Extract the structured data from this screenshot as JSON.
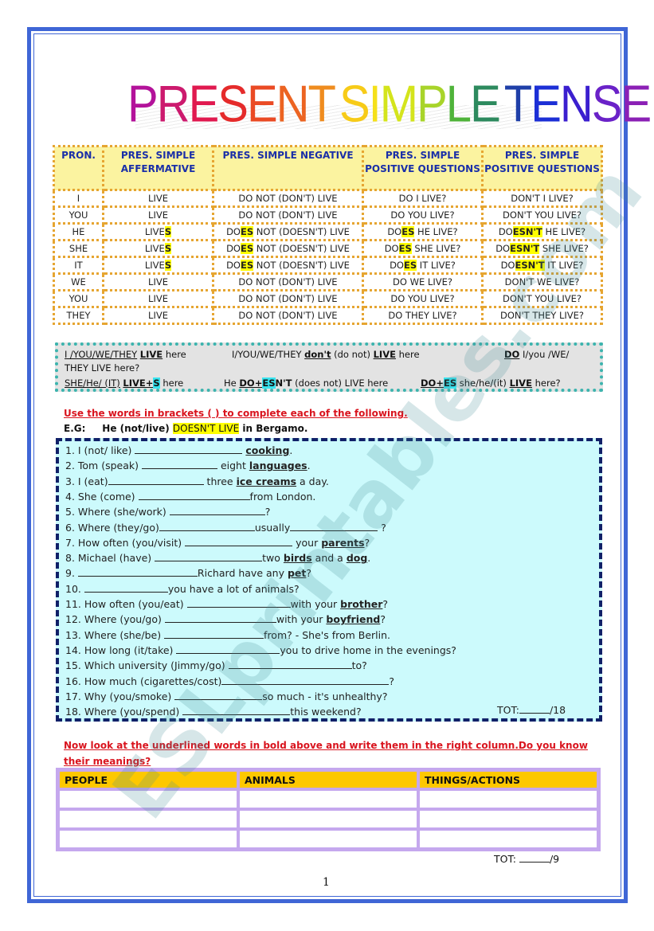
{
  "title": {
    "letters": [
      {
        "ch": "P",
        "color": "#b3129a"
      },
      {
        "ch": "R",
        "color": "#cc1a6e"
      },
      {
        "ch": "E",
        "color": "#e0194f"
      },
      {
        "ch": "S",
        "color": "#e52b2b"
      },
      {
        "ch": "E",
        "color": "#ea4a24"
      },
      {
        "ch": "N",
        "color": "#ec6422"
      },
      {
        "ch": "T",
        "color": "#ef8c1f"
      },
      {
        "ch": " ",
        "color": "#ffffff"
      },
      {
        "ch": "S",
        "color": "#f7cb18"
      },
      {
        "ch": "I",
        "color": "#f5e01a"
      },
      {
        "ch": "M",
        "color": "#d4e41c"
      },
      {
        "ch": "P",
        "color": "#a8d42a"
      },
      {
        "ch": "L",
        "color": "#4fb33a"
      },
      {
        "ch": "E",
        "color": "#2d8a5e"
      },
      {
        "ch": " ",
        "color": "#ffffff"
      },
      {
        "ch": "T",
        "color": "#1f3fa8"
      },
      {
        "ch": "E",
        "color": "#1c2fd6"
      },
      {
        "ch": "N",
        "color": "#3b1fcf"
      },
      {
        "ch": "S",
        "color": "#6a22c8"
      },
      {
        "ch": "E",
        "color": "#8b20b5"
      }
    ]
  },
  "conjugation": {
    "headers": [
      "PRON.",
      "PRES. SIMPLE AFFERMATIVE",
      "PRES. SIMPLE NEGATIVE",
      "PRES. SIMPLE POSITIVE QUESTIONS",
      "PRES. SIMPLE POSITIVE QUESTIONS"
    ],
    "rows": [
      {
        "pron": "I",
        "aff": [
          "LIVE",
          "",
          ""
        ],
        "neg": [
          "DO",
          "",
          " NOT (DON'T) LIVE"
        ],
        "q": [
          "DO",
          "",
          " I LIVE?"
        ],
        "nq": [
          "DON'T",
          "",
          " I LIVE?"
        ]
      },
      {
        "pron": "YOU",
        "aff": [
          "LIVE",
          "",
          ""
        ],
        "neg": [
          "DO",
          "",
          " NOT (DON'T) LIVE"
        ],
        "q": [
          "DO",
          "",
          " YOU LIVE?"
        ],
        "nq": [
          "DON'T",
          "",
          " YOU LIVE?"
        ]
      },
      {
        "pron": "HE",
        "aff": [
          "LIVE",
          "S",
          ""
        ],
        "neg": [
          "DO",
          "ES",
          " NOT (DOESN'T) LIVE"
        ],
        "q": [
          "DO",
          "ES",
          " HE LIVE?"
        ],
        "nq": [
          "DO",
          "ESN'T",
          " HE LIVE?"
        ]
      },
      {
        "pron": "SHE",
        "aff": [
          "LIVE",
          "S",
          ""
        ],
        "neg": [
          "DO",
          "ES",
          " NOT (DOESN'T) LIVE"
        ],
        "q": [
          "DO",
          "ES",
          " SHE LIVE?"
        ],
        "nq": [
          "DO",
          "ESN'T",
          " SHE LIVE?"
        ]
      },
      {
        "pron": "IT",
        "aff": [
          "LIVE",
          "S",
          ""
        ],
        "neg": [
          "DO",
          "ES",
          " NOT (DOESN'T) LIVE"
        ],
        "q": [
          "DO",
          "ES",
          " IT LIVE?"
        ],
        "nq": [
          "DO",
          "ESN'T",
          " IT LIVE?"
        ]
      },
      {
        "pron": "WE",
        "aff": [
          "LIVE",
          "",
          ""
        ],
        "neg": [
          "DO",
          "",
          " NOT (DON'T) LIVE"
        ],
        "q": [
          "DO",
          "",
          " WE LIVE?"
        ],
        "nq": [
          "DON'T",
          "",
          " WE LIVE?"
        ]
      },
      {
        "pron": "YOU",
        "aff": [
          "LIVE",
          "",
          ""
        ],
        "neg": [
          "DO",
          "",
          " NOT (DON'T) LIVE"
        ],
        "q": [
          "DO",
          "",
          " YOU LIVE?"
        ],
        "nq": [
          "DON'T",
          "",
          " YOU LIVE?"
        ]
      },
      {
        "pron": "THEY",
        "aff": [
          "LIVE",
          "",
          ""
        ],
        "neg": [
          "DO",
          "",
          " NOT (DON'T) LIVE"
        ],
        "q": [
          "DO",
          "",
          " THEY LIVE?"
        ],
        "nq": [
          "DON'T",
          "",
          " THEY LIVE?"
        ]
      }
    ]
  },
  "rules": {
    "r1a_subject": "I /YOU/WE/THEY",
    "r1a_verb": "LIVE",
    "r1a_rest": " here",
    "r1b_subject": "I/YOU/WE/THEY ",
    "r1b_aux": "don't",
    "r1b_mid": " (do not) ",
    "r1b_verb": "LIVE",
    "r1b_rest": " here",
    "r1c_aux": "DO",
    "r1c_rest": " I/you /WE/",
    "r1c_cont": "THEY LIVE here?",
    "r2a_subject": "SHE/He/ (IT)",
    "r2a_verb": "LIVE+",
    "r2a_s": "S",
    "r2a_rest": " here",
    "r2b_subject": "He ",
    "r2b_aux1": "DO+",
    "r2b_es": "ES",
    "r2b_aux2": "N'T",
    "r2b_rest": " (does not) LIVE here",
    "r2c_aux": "DO+",
    "r2c_es": "ES",
    "r2c_mid": " she/he/(it) ",
    "r2c_verb": "LIVE",
    "r2c_rest": " here?"
  },
  "instruction": "Use the words in brackets (    ) to complete each of the following.",
  "example": {
    "label": "E.G:",
    "prompt": "He (not/live)",
    "answer": "DOESN'T LIVE",
    "rest": "in Bergamo."
  },
  "exercises": [
    {
      "pre": "1. I (not/ like) ",
      "blank": 1,
      "post": " ",
      "bold": "cooking",
      "end": "."
    },
    {
      "pre": "2. Tom (speak) ",
      "blank": 1,
      "post": " eight ",
      "bold": "languages",
      "end": "."
    },
    {
      "pre": "3. I (eat)",
      "blank": 1,
      "post": " three ",
      "bold": "ice creams",
      "end": " a day."
    },
    {
      "pre": "4. She (come)  ",
      "blank": 1,
      "post": "from London.",
      "bold": "",
      "end": ""
    },
    {
      "pre": "5. Where (she/work) ",
      "blank": 1,
      "post": "?",
      "bold": "",
      "end": ""
    },
    {
      "pre": "6. Where (they/go)",
      "blank": 1,
      "post": "usually",
      "bold": "",
      "end": " ?",
      "blank2": 1
    },
    {
      "pre": "7. How often (you/visit) ",
      "blank": 1,
      "post": " your ",
      "bold": "parents",
      "end": "?"
    },
    {
      "pre": "8. Michael (have) ",
      "blank": 1,
      "post": "two ",
      "bold": "birds",
      "end": " and a ",
      "bold2": "dog",
      "end2": "."
    },
    {
      "pre": "9. ",
      "blank": 1,
      "post": "Richard have any ",
      "bold": "pet",
      "end": "?"
    },
    {
      "pre": "10. ",
      "blank": 1,
      "post": "you have a lot of animals?",
      "bold": "",
      "end": ""
    },
    {
      "pre": "11. How often (you/eat) ",
      "blank": 1,
      "post": "with your ",
      "bold": "brother",
      "end": "?"
    },
    {
      "pre": "12. Where (you/go) ",
      "blank": 1,
      "post": "with your ",
      "bold": "boyfriend",
      "end": "?"
    },
    {
      "pre": "13. Where (she/be) ",
      "blank": 1,
      "post": "from? - She's from Berlin.",
      "bold": "",
      "end": ""
    },
    {
      "pre": "14. How long (it/take) ",
      "blank": 1,
      "post": "you to drive home in the evenings?",
      "bold": "",
      "end": ""
    },
    {
      "pre": "15. Which university (Jimmy/go) ",
      "blank": 1,
      "post": "to?",
      "bold": "",
      "end": ""
    },
    {
      "pre": "16. How much (cigarettes/cost)",
      "blank": 1,
      "post": "?",
      "bold": "",
      "end": ""
    },
    {
      "pre": "17. Why (you/smoke) ",
      "blank": 1,
      "post": "so much - it's unhealthy?",
      "bold": "",
      "end": ""
    },
    {
      "pre": "18. Where (you/spend) ",
      "blank": 1,
      "post": "this weekend?",
      "bold": "",
      "end": ""
    }
  ],
  "exercise_total": {
    "label": "TOT:",
    "max": "/18"
  },
  "instruction2": "Now look at the underlined words in bold above and write them in the right column.Do you know their meanings?",
  "vocab_table": {
    "headers": [
      "PEOPLE",
      "ANIMALS",
      "THINGS/ACTIONS"
    ],
    "rows": [
      [
        "",
        "",
        ""
      ],
      [
        "",
        "",
        ""
      ],
      [
        "",
        "",
        ""
      ]
    ]
  },
  "vocab_total": {
    "label": "TOT:",
    "max": "/9"
  },
  "page_number": "1",
  "watermark": "ESLprintables.com"
}
